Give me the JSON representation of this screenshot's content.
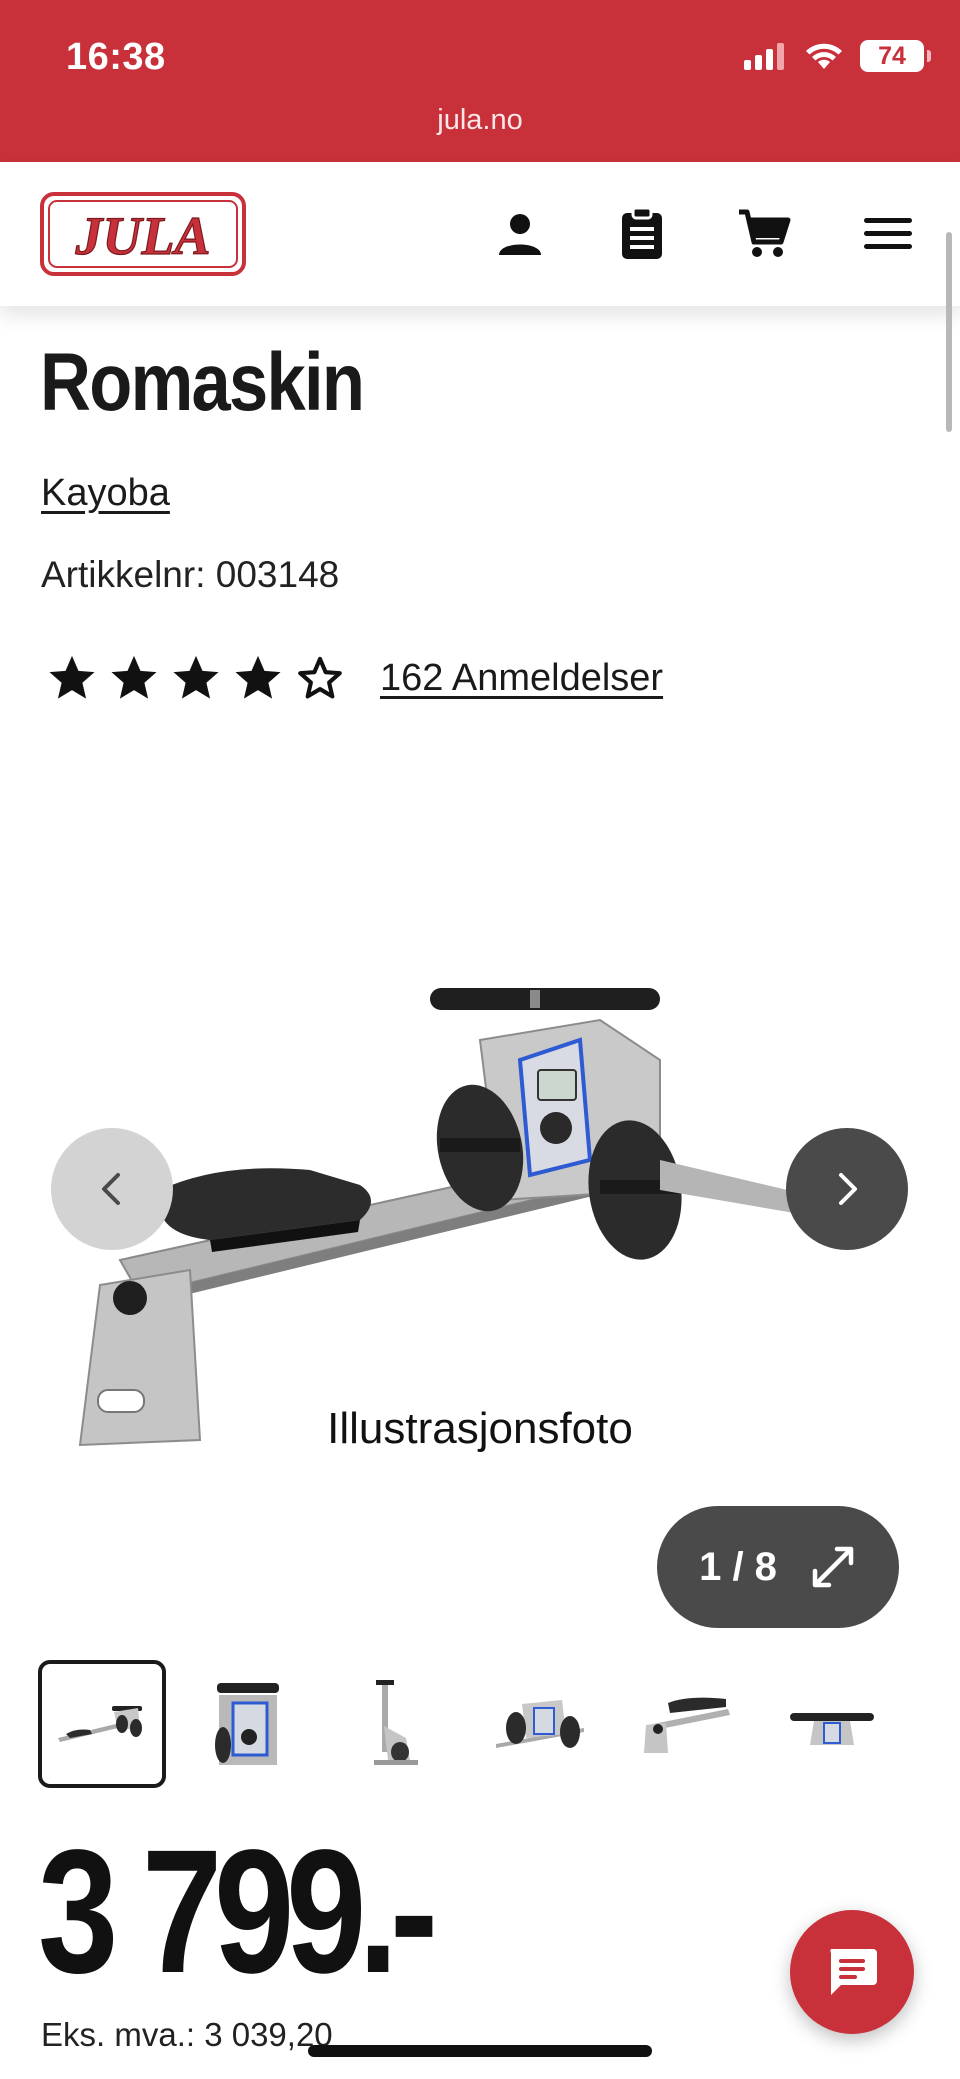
{
  "status_bar": {
    "time": "16:38",
    "url": "jula.no",
    "battery": "74",
    "icons": [
      "cellular-signal-icon",
      "wifi-icon",
      "battery-icon"
    ]
  },
  "header": {
    "logo_text": "JULA",
    "icons": [
      "account-icon",
      "clipboard-list-icon",
      "cart-icon",
      "menu-icon"
    ]
  },
  "product": {
    "title": "Romaskin",
    "brand": "Kayoba",
    "article_number": "Artikkelnr: 003148",
    "rating": {
      "value": 4,
      "max": 5
    },
    "reviews_label": "162 Anmeldelser"
  },
  "gallery": {
    "caption": "Illustrasjonsfoto",
    "counter": "1 / 8",
    "current_index": 1,
    "total_images": 8,
    "thumbnail_count_visible": 6
  },
  "pricing": {
    "price": "3 799.-",
    "ex_vat": "Eks. mva.: 3 039,20"
  },
  "colors": {
    "brand_red": "#c8303a",
    "dark_button": "#4a4a4a",
    "light_button": "#d3d3d3",
    "text": "#1a1a1a"
  }
}
